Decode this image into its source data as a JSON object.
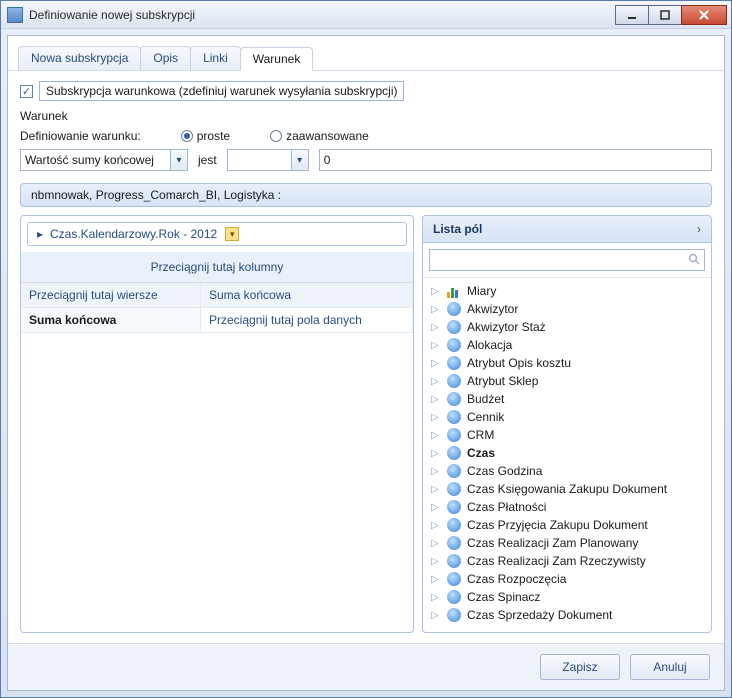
{
  "window": {
    "title": "Definiowanie nowej subskrypcji"
  },
  "tabs": [
    {
      "label": "Nowa subskrypcja"
    },
    {
      "label": "Opis"
    },
    {
      "label": "Linki"
    },
    {
      "label": "Warunek"
    }
  ],
  "conditional": {
    "checkbox_label": "Subskrypcja warunkowa (zdefiniuj warunek wysyłania subskrypcji)",
    "section_label": "Warunek",
    "def_label": "Definiowanie warunku:",
    "mode_simple": "proste",
    "mode_advanced": "zaawansowane",
    "select_field": "Wartość sumy końcowej",
    "operator_label": "jest",
    "operator_value": "",
    "value": "0"
  },
  "cube": {
    "path": "nbmnowak, Progress_Comarch_BI, Logistyka :"
  },
  "filter": {
    "chip": "Czas.Kalendarzowy.Rok - 2012"
  },
  "pivot": {
    "col_drop": "Przeciągnij tutaj kolumny",
    "row_drop": "Przeciągnij tutaj wiersze",
    "col_header": "Suma końcowa",
    "row_label": "Suma końcowa",
    "data_drop": "Przeciągnij tutaj pola danych"
  },
  "fieldlist": {
    "title": "Lista pól",
    "search_placeholder": "",
    "items": [
      {
        "label": "Miary",
        "type": "measure"
      },
      {
        "label": "Akwizytor",
        "type": "dim"
      },
      {
        "label": "Akwizytor Staż",
        "type": "dim"
      },
      {
        "label": "Alokacja",
        "type": "dim"
      },
      {
        "label": "Atrybut Opis kosztu",
        "type": "dim"
      },
      {
        "label": "Atrybut Sklep",
        "type": "dim"
      },
      {
        "label": "Budżet",
        "type": "dim"
      },
      {
        "label": "Cennik",
        "type": "dim"
      },
      {
        "label": "CRM",
        "type": "dim"
      },
      {
        "label": "Czas",
        "type": "dim",
        "bold": true
      },
      {
        "label": "Czas Godzina",
        "type": "dim"
      },
      {
        "label": "Czas Księgowania Zakupu Dokument",
        "type": "dim"
      },
      {
        "label": "Czas Płatności",
        "type": "dim"
      },
      {
        "label": "Czas Przyjęcia Zakupu Dokument",
        "type": "dim"
      },
      {
        "label": "Czas Realizacji Zam Planowany",
        "type": "dim"
      },
      {
        "label": "Czas Realizacji Zam Rzeczywisty",
        "type": "dim"
      },
      {
        "label": "Czas Rozpoczęcia",
        "type": "dim"
      },
      {
        "label": "Czas Spinacz",
        "type": "dim"
      },
      {
        "label": "Czas Sprzedaży Dokument",
        "type": "dim"
      }
    ]
  },
  "footer": {
    "save": "Zapisz",
    "cancel": "Anuluj"
  }
}
